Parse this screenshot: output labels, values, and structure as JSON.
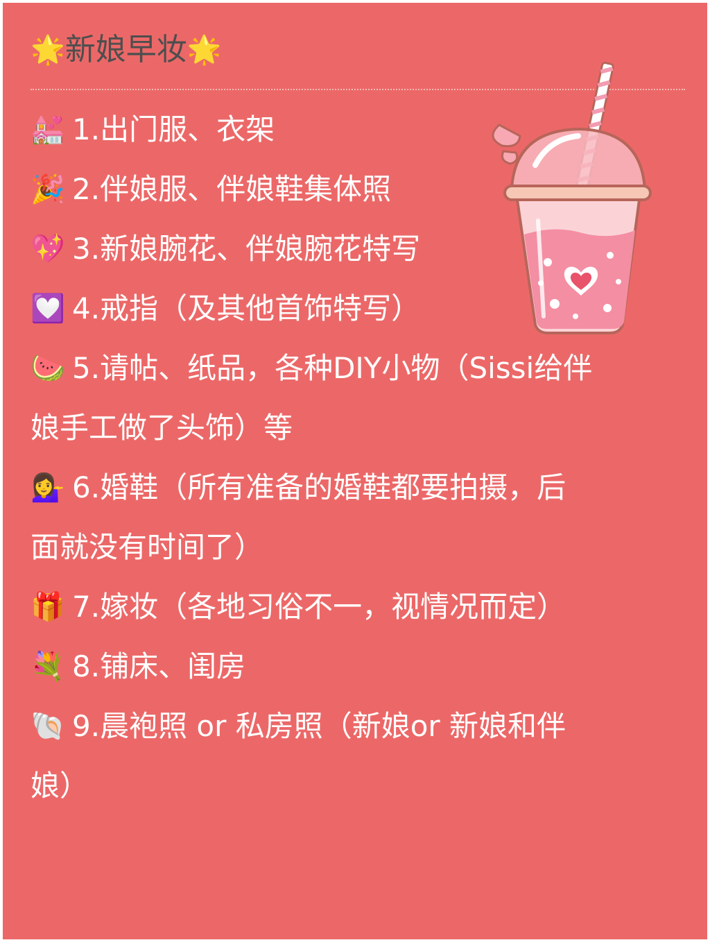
{
  "header": {
    "title": "新娘早妆",
    "star_left": "🌟",
    "star_right": "🌟"
  },
  "items": [
    {
      "icon": "wedding-chapel-icon",
      "emoji": "💒",
      "line1": "1.出门服、衣架"
    },
    {
      "icon": "party-popper-icon",
      "emoji": "🎉",
      "line1": "2.伴娘服、伴娘鞋集体照"
    },
    {
      "icon": "sparkling-heart-icon",
      "emoji": "💖",
      "line1": "3.新娘腕花、伴娘腕花特写"
    },
    {
      "icon": "white-heart-icon",
      "emoji": "💟",
      "line1": "4.戒指（及其他首饰特写）"
    },
    {
      "icon": "watermelon-icon",
      "emoji": "🍉",
      "line1": "5.请帖、纸品，各种DIY小物（Sissi给伴",
      "line2": "娘手工做了头饰）等"
    },
    {
      "icon": "woman-tipping-hand-icon",
      "emoji": "💁‍♀️",
      "line1": "6.婚鞋（所有准备的婚鞋都要拍摄，后",
      "line2": "面就没有时间了）"
    },
    {
      "icon": "gift-icon",
      "emoji": "🎁",
      "line1": "7.嫁妆（各地习俗不一，视情况而定）"
    },
    {
      "icon": "bouquet-icon",
      "emoji": "💐",
      "line1": "8.铺床、闺房"
    },
    {
      "icon": "spiral-shell-icon",
      "emoji": "🐚",
      "line1": "9.晨袍照 or 私房照（新娘or 新娘和伴",
      "line2": "娘）"
    }
  ],
  "colors": {
    "background": "#ec6868",
    "text": "#ffffff",
    "title_text": "#4e4e4e"
  },
  "illustration": "pink-drink-cup-with-heart-icon"
}
